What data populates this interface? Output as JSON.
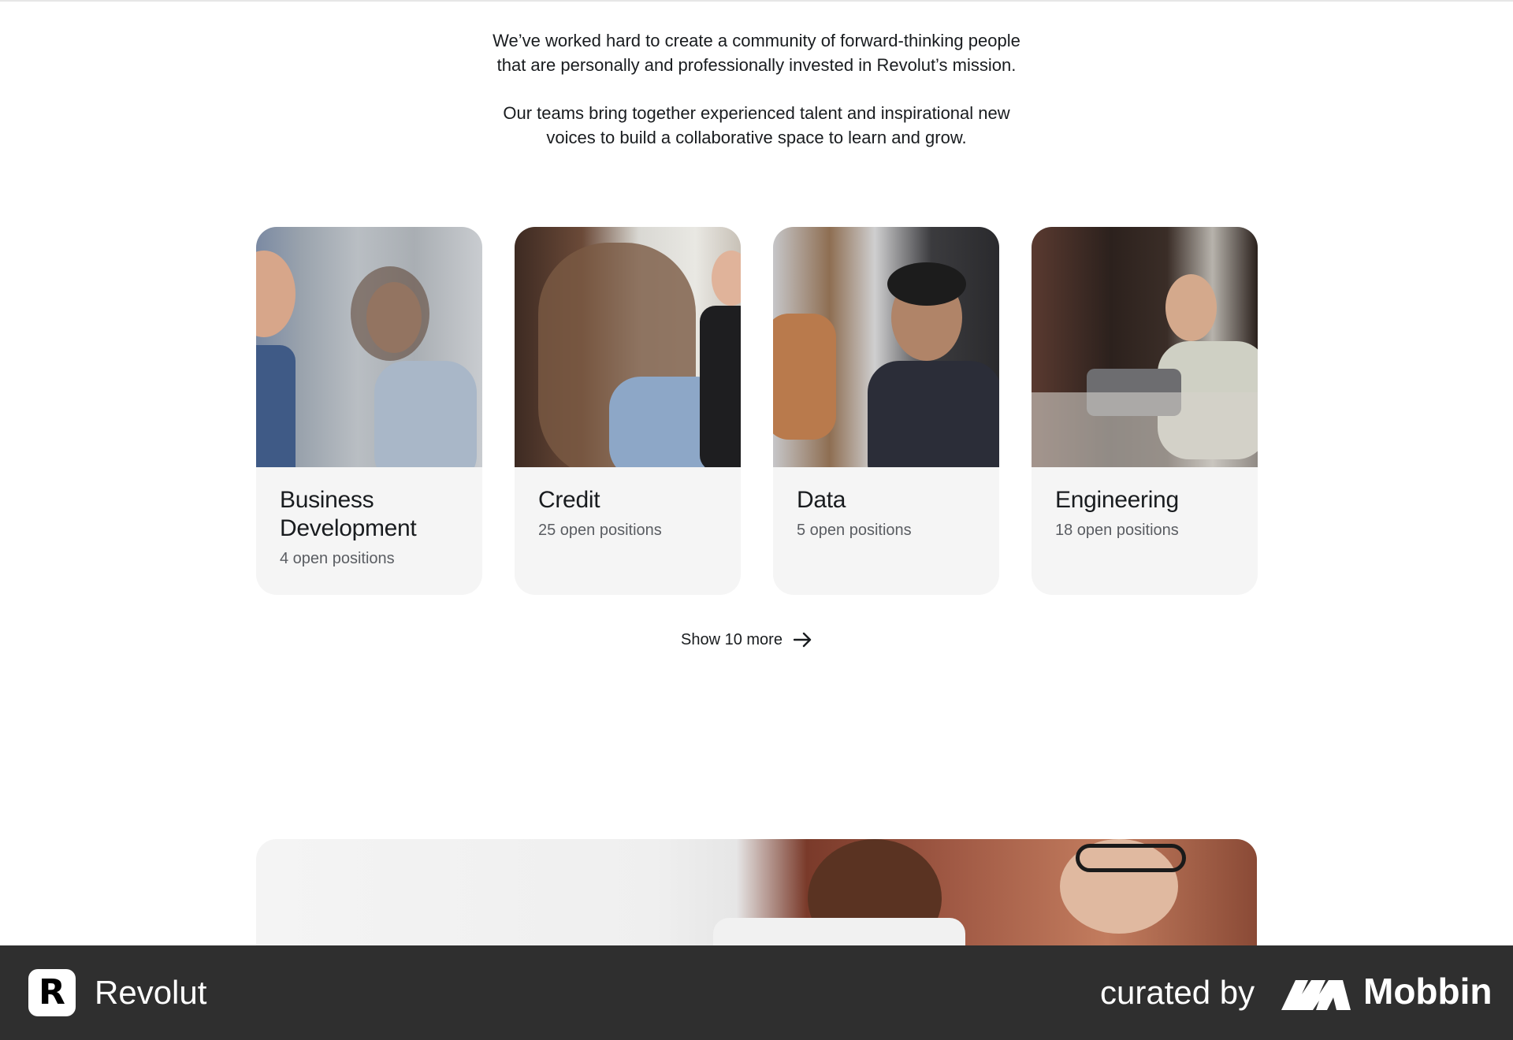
{
  "intro": {
    "para1_line1": "We’ve worked hard to create a community of forward-thinking people",
    "para1_line2": "that are personally and professionally invested in Revolut’s mission.",
    "para2_line1": "Our teams bring together experienced talent and inspirational new",
    "para2_line2": "voices to build a collaborative space to learn and grow."
  },
  "teams": [
    {
      "title_line1": "Business",
      "title_line2": "Development",
      "positions": "4 open positions"
    },
    {
      "title_line1": "Credit",
      "title_line2": "",
      "positions": "25 open positions"
    },
    {
      "title_line1": "Data",
      "title_line2": "",
      "positions": "5 open positions"
    },
    {
      "title_line1": "Engineering",
      "title_line2": "",
      "positions": "18 open positions"
    }
  ],
  "show_more": {
    "label": "Show 10 more"
  },
  "footer": {
    "logo_letter": "R",
    "brand": "Revolut",
    "curated_by": "curated by",
    "mobbin": "Mobbin"
  },
  "colors": {
    "text": "#191c1f",
    "muted": "#5a5d62",
    "card_bg": "#f5f5f5",
    "footer_bg": "#2f2f2f"
  }
}
